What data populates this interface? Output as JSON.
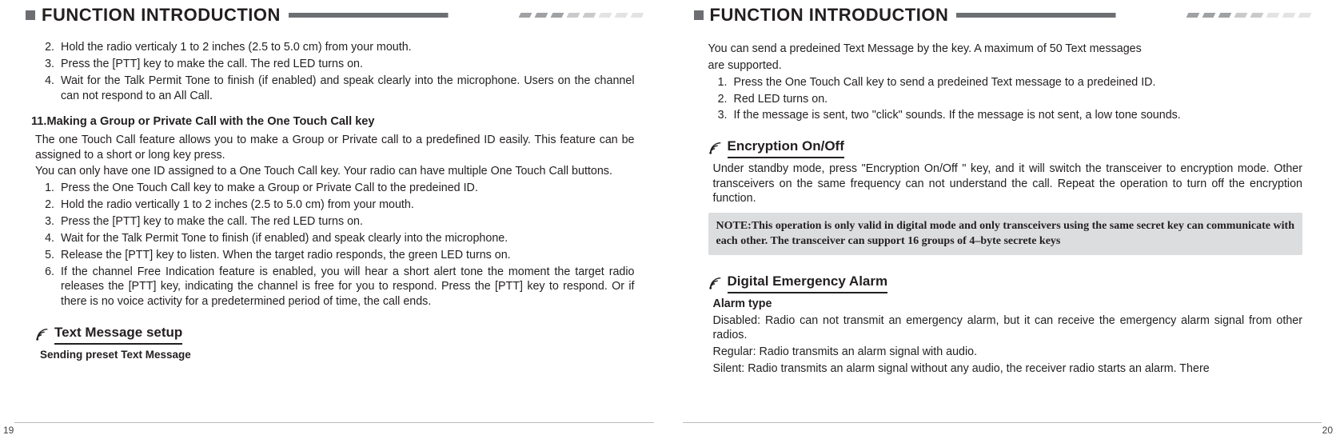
{
  "header": {
    "title": "FUNCTION INTRODUCTION"
  },
  "left": {
    "list_a": {
      "start": 2,
      "items": [
        "Hold the radio verticaly 1 to 2 inches (2.5 to 5.0 cm) from your mouth.",
        "Press the [PTT] key to make the call. The red LED turns on.",
        "Wait for the Talk Permit Tone to finish (if enabled) and speak clearly into the microphone. Users on the channel can not respond to an All Call."
      ]
    },
    "s11_title": "11.Making a Group or Private Call with the One Touch Call key",
    "s11_p1": "The one Touch Call feature allows you to make a Group or Private call to a predefined ID easily. This feature can be assigned to a short or long  key press.",
    "s11_p2": "You can only have one ID assigned to a One Touch Call key. Your radio can have multiple One Touch Call buttons.",
    "list_b": {
      "start": 1,
      "items": [
        "Press the One Touch Call key to make a Group or Private Call to the predeined ID.",
        "Hold the radio vertically 1 to 2 inches (2.5 to 5.0 cm) from your mouth.",
        "Press the [PTT] key to make the call. The red LED turns on.",
        "Wait for the Talk Permit Tone to finish (if enabled) and speak clearly into the microphone.",
        "Release the [PTT] key to listen. When the target radio responds, the green LED turns on.",
        "If the channel Free Indication feature is enabled, you will hear a short alert tone the moment the target radio releases the [PTT] key, indicating the channel is free for you to respond. Press the [PTT] key to respond. Or if there is no voice activity for a predetermined period of time, the call ends."
      ]
    },
    "sub1": "Text Message setup",
    "sub1b": "Sending preset Text Message",
    "pagenum": "19"
  },
  "right": {
    "p1": "You can send a predeined Text Message by the  key. A maximum of 50 Text messages",
    "p1b": "are supported.",
    "list_c": {
      "start": 1,
      "items": [
        "Press the One Touch Call key to send a predeined Text message to a predeined ID.",
        "Red LED turns on.",
        "If the message is sent, two \"click\" sounds. If the message is not sent, a low tone sounds."
      ]
    },
    "sub_enc": "Encryption On/Off",
    "enc_p": "Under standby mode, press  \"Encryption On/Off \" key, and it will switch the transceiver to encryption mode. Other transceivers on the same frequency can not understand the call. Repeat the operation to turn off the encryption function.",
    "note": "NOTE:This operation is only valid in digital mode and only transceivers using the same secret key can communicate with each other. The transceiver can support 16 groups of 4–byte secrete keys",
    "sub_alarm": "Digital Emergency Alarm",
    "alarm_label": "Alarm type",
    "alarm_p1": "Disabled: Radio can not transmit an emergency alarm, but it can receive the emergency alarm signal from other radios.",
    "alarm_p2": "Regular: Radio transmits an alarm signal with audio.",
    "alarm_p3": "Silent: Radio transmits an alarm signal without any audio, the receiver radio starts an alarm. There",
    "pagenum": "20"
  }
}
